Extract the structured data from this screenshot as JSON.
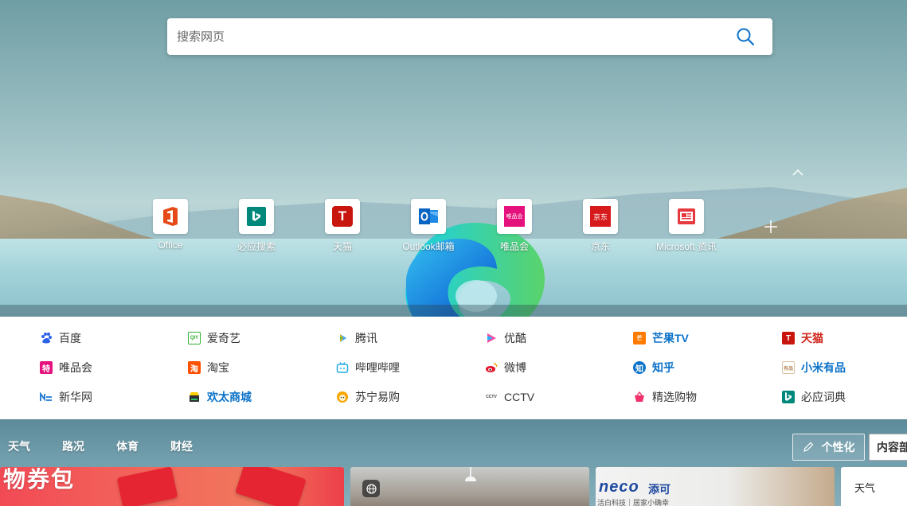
{
  "search": {
    "placeholder": "搜索网页"
  },
  "quick_links": [
    {
      "label": "Office",
      "icon": "office-icon"
    },
    {
      "label": "必应搜索",
      "icon": "bing-icon"
    },
    {
      "label": "天猫",
      "icon": "tmall-icon"
    },
    {
      "label": "Outlook邮箱",
      "icon": "outlook-icon"
    },
    {
      "label": "唯品会",
      "icon": "vipshop-icon"
    },
    {
      "label": "京东",
      "icon": "jd-icon"
    },
    {
      "label": "Microsoft 资讯",
      "icon": "msn-icon"
    }
  ],
  "quick_link_logos": {
    "tmall": "T",
    "vipshop": "唯品会",
    "jd": "京东"
  },
  "sites": [
    [
      {
        "label": "百度"
      },
      {
        "label": "爱奇艺"
      },
      {
        "label": "腾讯"
      },
      {
        "label": "优酷"
      },
      {
        "label": "芒果TV",
        "style": "blue"
      },
      {
        "label": "天猫",
        "style": "red"
      }
    ],
    [
      {
        "label": "唯品会"
      },
      {
        "label": "淘宝"
      },
      {
        "label": "哔哩哔哩"
      },
      {
        "label": "微博"
      },
      {
        "label": "知乎",
        "style": "blue"
      },
      {
        "label": "小米有品",
        "style": "blue"
      }
    ],
    [
      {
        "label": "新华网"
      },
      {
        "label": "欢太商城",
        "style": "blue"
      },
      {
        "label": "苏宁易购"
      },
      {
        "label": "CCTV"
      },
      {
        "label": "精选购物"
      },
      {
        "label": "必应词典"
      }
    ]
  ],
  "site_icon_glyphs": {
    "iqiyi": "QIY",
    "zhihu": "知",
    "vip": "特",
    "taobao": "淘",
    "tmall": "T",
    "mango": "芒",
    "xiaomi": "有品",
    "cctv": "CCTV"
  },
  "news_tabs": [
    "天气",
    "路况",
    "体育",
    "财经"
  ],
  "buttons": {
    "personalize": "个性化",
    "content": "内容部"
  },
  "cards": {
    "card1_text": "物券包",
    "card3_brand": "neco",
    "card3_brand_cn": "添可",
    "card3_sub": "活白科技｜居家小确幸",
    "weather": "天气"
  },
  "colors": {
    "accent": "#0a72c9",
    "highlight_red": "#d0261b"
  }
}
